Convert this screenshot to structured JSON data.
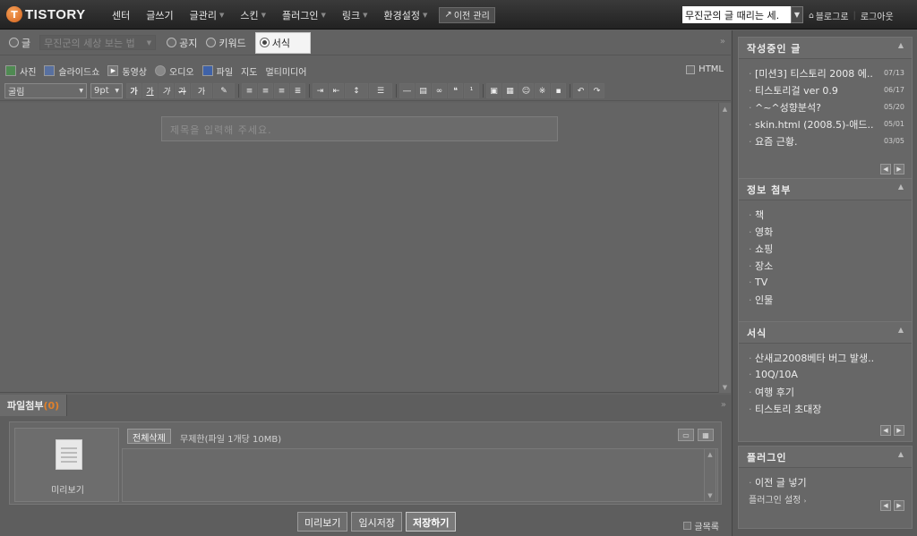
{
  "topbar": {
    "logo_mark": "T",
    "logo_text": "TISTORY",
    "nav": [
      {
        "label": "센터",
        "dropdown": false
      },
      {
        "label": "글쓰기",
        "dropdown": false
      },
      {
        "label": "글관리",
        "dropdown": true
      },
      {
        "label": "스킨",
        "dropdown": true
      },
      {
        "label": "플러그인",
        "dropdown": true
      },
      {
        "label": "링크",
        "dropdown": true
      },
      {
        "label": "환경설정",
        "dropdown": true
      }
    ],
    "legacy_button": "이전 관리",
    "blog_select": "무진군의 글 때리는 세.",
    "blog_link": "블로그로",
    "logout": "로그아웃"
  },
  "post_type": {
    "options": [
      "글",
      "공지",
      "키워드",
      "서식"
    ],
    "selected": "서식",
    "category_placeholder": "무진군의 세상 보는 법"
  },
  "media": {
    "items": [
      "사진",
      "슬라이드쇼",
      "동영상",
      "오디오",
      "파일",
      "지도",
      "멀티미디어"
    ],
    "html_label": "HTML"
  },
  "format": {
    "font": "굴림",
    "size": "9pt",
    "buttons": [
      "가",
      "가",
      "가",
      "가",
      "가",
      "가"
    ]
  },
  "editor": {
    "title_placeholder": "제목을 입력해 주세요."
  },
  "attach": {
    "tab_label": "파일첨부",
    "tab_count": "(0)",
    "preview_label": "미리보기",
    "delete_all": "전체삭제",
    "limit_text": "무제한(파일 1개당 10MB)"
  },
  "actions": {
    "preview": "미리보기",
    "draft": "임시저장",
    "save": "저장하기",
    "post_list": "글목록"
  },
  "sidebar": {
    "drafts": {
      "title": "작성중인 글",
      "items": [
        {
          "title": "[미션3] 티스토리 2008 에..",
          "date": "07/13"
        },
        {
          "title": "티스토리걸 ver 0.9",
          "date": "06/17"
        },
        {
          "title": "^~^성향분석?",
          "date": "05/20"
        },
        {
          "title": "skin.html (2008.5)-애드..",
          "date": "05/01"
        },
        {
          "title": "요즘 근황.",
          "date": "03/05"
        }
      ]
    },
    "info": {
      "title": "정보 첨부",
      "items": [
        "책",
        "영화",
        "쇼핑",
        "장소",
        "TV",
        "인물"
      ]
    },
    "templates": {
      "title": "서식",
      "items": [
        "산새교2008베타 버그 발생..",
        "10Q/10A",
        "여행 후기",
        "티스토리 초대장"
      ]
    },
    "plugins": {
      "title": "플러그인",
      "items": [
        "이전 글 넣기"
      ],
      "settings": "플러그인 설정"
    }
  }
}
